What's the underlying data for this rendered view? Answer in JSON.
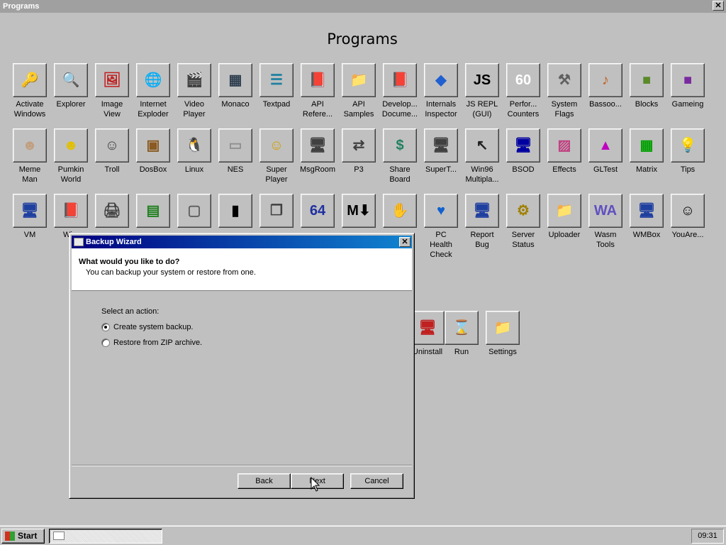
{
  "window": {
    "title": "Programs",
    "close_label": "✕",
    "heading": "Programs"
  },
  "programs": [
    {
      "label": "Activate\nWindows",
      "icon": "keys-icon",
      "glyph": "🔑",
      "color": "#808080"
    },
    {
      "label": "Explorer",
      "icon": "magnifier-icon",
      "glyph": "🔍",
      "color": "#c0a000"
    },
    {
      "label": "Image\nView",
      "icon": "image-view-icon",
      "glyph": "🖼",
      "color": "#c02020"
    },
    {
      "label": "Internet\nExploder",
      "icon": "globe-icon",
      "glyph": "🌐",
      "color": "#206020"
    },
    {
      "label": "Video\nPlayer",
      "icon": "video-file-icon",
      "glyph": "🎬",
      "color": "#404040"
    },
    {
      "label": "Monaco",
      "icon": "monaco-icon",
      "glyph": "▦",
      "color": "#304050"
    },
    {
      "label": "Textpad",
      "icon": "notepad-icon",
      "glyph": "☰",
      "color": "#2080a0"
    },
    {
      "label": "API\nRefere...",
      "icon": "help-book-icon",
      "glyph": "📕",
      "color": "#a020a0"
    },
    {
      "label": "API\nSamples",
      "icon": "folder-shortcut-icon",
      "glyph": "📁",
      "color": "#c0b000"
    },
    {
      "label": "Develop...\nDocume...",
      "icon": "help-book-icon",
      "glyph": "📕",
      "color": "#a020a0"
    },
    {
      "label": "Internals\nInspector",
      "icon": "diamond-icon",
      "glyph": "◆",
      "color": "#2060d0"
    },
    {
      "label": "JS REPL\n(GUI)",
      "icon": "js-icon",
      "glyph": "JS",
      "color": "#000000"
    },
    {
      "label": "Perfor...\nCounters",
      "icon": "counter-60-icon",
      "glyph": "60",
      "color": "#ffffff"
    },
    {
      "label": "System\nFlags",
      "icon": "tools-icon",
      "glyph": "⚒",
      "color": "#606060"
    },
    {
      "label": "Bassoo...",
      "icon": "bassoon-icon",
      "glyph": "♪",
      "color": "#c06020"
    },
    {
      "label": "Blocks",
      "icon": "grass-block-icon",
      "glyph": "■",
      "color": "#5a8a2a"
    },
    {
      "label": "Gameing",
      "icon": "purple-cube-icon",
      "glyph": "■",
      "color": "#7a2aa0"
    },
    {
      "label": "Meme\nMan",
      "icon": "meme-man-icon",
      "glyph": "☻",
      "color": "#c0a080"
    },
    {
      "label": "Pumkin\nWorld",
      "icon": "pumpkin-icon",
      "glyph": "☻",
      "color": "#e0c000"
    },
    {
      "label": "Troll",
      "icon": "troll-face-icon",
      "glyph": "☺",
      "color": "#404040"
    },
    {
      "label": "DosBox",
      "icon": "dosbox-icon",
      "glyph": "▣",
      "color": "#8a5a20"
    },
    {
      "label": "Linux",
      "icon": "penguin-icon",
      "glyph": "🐧",
      "color": "#000000"
    },
    {
      "label": "NES",
      "icon": "nes-console-icon",
      "glyph": "▭",
      "color": "#909090"
    },
    {
      "label": "Super\nPlayer",
      "icon": "smiley-icon",
      "glyph": "☺",
      "color": "#d0a000"
    },
    {
      "label": "MsgRoom",
      "icon": "message-computer-icon",
      "glyph": "🖥",
      "color": "#404040"
    },
    {
      "label": "P3",
      "icon": "network-icon",
      "glyph": "⇄",
      "color": "#404040"
    },
    {
      "label": "Share\nBoard",
      "icon": "share-board-icon",
      "glyph": "$",
      "color": "#208060"
    },
    {
      "label": "SuperT...",
      "icon": "computer-icon",
      "glyph": "🖥",
      "color": "#404040"
    },
    {
      "label": "Win96\nMultipla...",
      "icon": "cursors-icon",
      "glyph": "↖",
      "color": "#202020"
    },
    {
      "label": "BSOD",
      "icon": "bsod-monitor-icon",
      "glyph": "🖥",
      "color": "#0000a0"
    },
    {
      "label": "Effects",
      "icon": "effects-monitor-icon",
      "glyph": "▨",
      "color": "#c04080"
    },
    {
      "label": "GLTest",
      "icon": "gl-cone-icon",
      "glyph": "▲",
      "color": "#c000c0"
    },
    {
      "label": "Matrix",
      "icon": "matrix-icon",
      "glyph": "▦",
      "color": "#00a000"
    },
    {
      "label": "Tips",
      "icon": "lightbulb-icon",
      "glyph": "💡",
      "color": "#e0c000"
    },
    {
      "label": "VM",
      "icon": "computer-icon",
      "glyph": "🖥",
      "color": "#2040a0"
    },
    {
      "label": "Wi...",
      "icon": "help-book-icon",
      "glyph": "📕",
      "color": "#a020a0"
    },
    {
      "label": "",
      "icon": "printer-icon",
      "glyph": "🖨",
      "color": "#404040"
    },
    {
      "label": "",
      "icon": "circuit-board-icon",
      "glyph": "▤",
      "color": "#208020"
    },
    {
      "label": "",
      "icon": "window-box-icon",
      "glyph": "▢",
      "color": "#606060"
    },
    {
      "label": "",
      "icon": "terminal-icon",
      "glyph": "▮",
      "color": "#000000"
    },
    {
      "label": "",
      "icon": "windows-stack-icon",
      "glyph": "❐",
      "color": "#404040"
    },
    {
      "label": "",
      "icon": "sixty-four-icon",
      "glyph": "64",
      "color": "#2030a0"
    },
    {
      "label": "",
      "icon": "markdown-icon",
      "glyph": "M⬇",
      "color": "#000000"
    },
    {
      "label": "",
      "icon": "stop-hand-icon",
      "glyph": "✋",
      "color": "#c00000"
    },
    {
      "label": "PC\nHealth\nCheck",
      "icon": "heartbeat-icon",
      "glyph": "♥",
      "color": "#1060d0"
    },
    {
      "label": "Report\nBug",
      "icon": "computer-icon",
      "glyph": "🖥",
      "color": "#2040a0"
    },
    {
      "label": "Server\nStatus",
      "icon": "server-gear-icon",
      "glyph": "⚙",
      "color": "#a08000"
    },
    {
      "label": "Uploader",
      "icon": "upload-folder-icon",
      "glyph": "📁",
      "color": "#c0a000"
    },
    {
      "label": "Wasm\nTools",
      "icon": "wasm-icon",
      "glyph": "WA",
      "color": "#6050c0"
    },
    {
      "label": "WMBox",
      "icon": "vm-box-icon",
      "glyph": "🖥",
      "color": "#2040a0"
    },
    {
      "label": "YouAre...",
      "icon": "smiley-outline-icon",
      "glyph": "☺",
      "color": "#000000"
    },
    {
      "label": "Uninstall",
      "icon": "uninstall-icon",
      "glyph": "🖥",
      "color": "#c02020"
    },
    {
      "label": "Run",
      "icon": "run-hourglass-icon",
      "glyph": "⌛",
      "color": "#404040"
    },
    {
      "label": "Settings",
      "icon": "settings-folder-icon",
      "glyph": "📁",
      "color": "#c0a000"
    }
  ],
  "wizard": {
    "title": "Backup Wizard",
    "close_label": "✕",
    "header_title": "What would you like to do?",
    "header_subtitle": "You can backup your system or restore from one.",
    "prompt": "Select an action:",
    "options": [
      {
        "label": "Create system backup.",
        "checked": true
      },
      {
        "label": "Restore from ZIP archive.",
        "checked": false
      }
    ],
    "back_label": "Back",
    "next_label": "Next",
    "cancel_label": "Cancel"
  },
  "taskbar": {
    "start_label": "Start",
    "clock": "09:31"
  }
}
